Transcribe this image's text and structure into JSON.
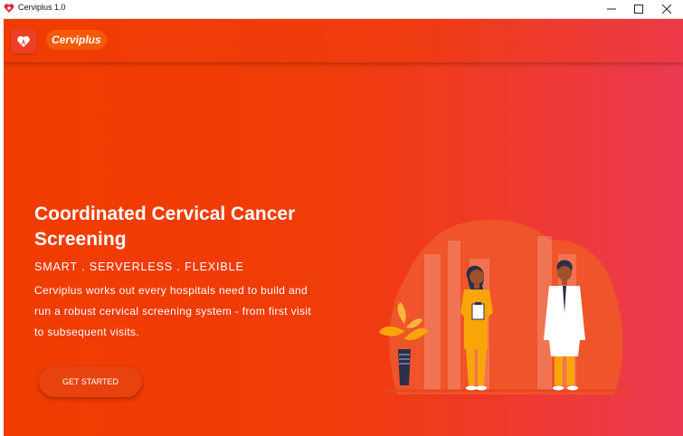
{
  "window": {
    "title": "Cerviplus 1.0",
    "controls": {
      "minimize": "—",
      "maximize": "☐",
      "close": "✕"
    }
  },
  "header": {
    "brand": "Cerviplus",
    "logo_icon": "heart-ribbon-icon"
  },
  "hero": {
    "title": "Coordinated Cervical Cancer Screening",
    "tagline": "SMART . SERVERLESS . FLEXIBLE",
    "description": "Cerviplus works out every hospitals need to build and run a robust cervical screening system - from first visit to subsequent visits.",
    "cta_label": "GET STARTED"
  },
  "illustration": {
    "name": "medical-staff-illustration",
    "colors": {
      "background_blob": "#f0542a",
      "nurse_uniform": "#f9a50a",
      "doctor_coat": "#ffffff",
      "skin": "#a0502a",
      "hair": "#2b2f4a",
      "plant_leaf": "#f9a50a",
      "pot": "#2b2f4a"
    }
  },
  "theme": {
    "gradient_start": "#f13c00",
    "gradient_end": "#ec3a52",
    "accent": "#f65a00"
  }
}
